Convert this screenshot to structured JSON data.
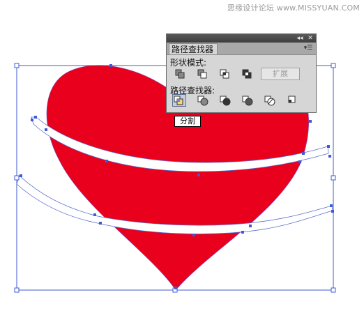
{
  "watermark": "思缘设计论坛 www.MISSYUAN.COM",
  "panel": {
    "tab_label": "路径查找器",
    "collapse_icon": "double-chevron-icon",
    "close_icon": "close-icon",
    "menu_icon": "panel-menu-icon",
    "shape_modes_label": "形状模式:",
    "shape_modes": [
      "unite-icon",
      "minus-front-icon",
      "intersect-icon",
      "exclude-icon"
    ],
    "expand_label": "扩展",
    "pathfinders_label": "路径查找器:",
    "pathfinders": [
      "divide-icon",
      "trim-icon",
      "merge-icon",
      "crop-icon",
      "outline-icon",
      "minus-back-icon"
    ]
  },
  "tooltip": "分割",
  "colors": {
    "heart": "#e8001c",
    "selection": "#3d5bd4",
    "panel_bg": "#d6d6d6",
    "panel_title": "#3c3c3c"
  }
}
